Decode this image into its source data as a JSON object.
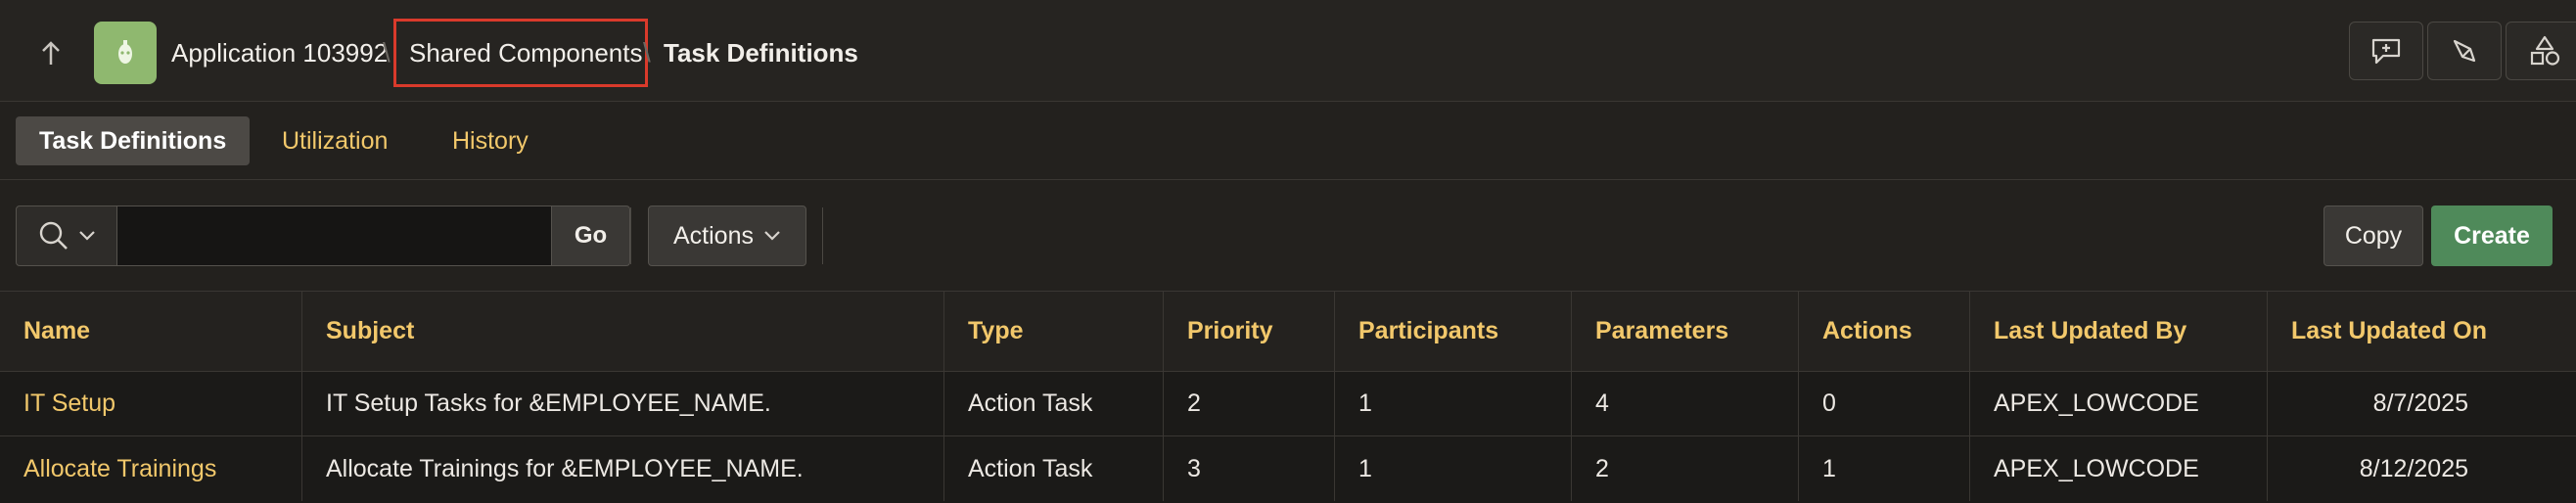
{
  "breadcrumb": {
    "app": "Application 103992",
    "shared": "Shared Components",
    "current": "Task Definitions"
  },
  "icons": {
    "up": "arrow-up-icon",
    "app": "app-icon",
    "feedback": "chat-plus-icon",
    "developer": "pen-icon",
    "shapes": "shapes-icon",
    "search": "magnifier-icon"
  },
  "tabs": [
    {
      "label": "Task Definitions",
      "active": true
    },
    {
      "label": "Utilization",
      "active": false
    },
    {
      "label": "History",
      "active": false
    }
  ],
  "toolbar": {
    "search_value": "",
    "go_label": "Go",
    "actions_label": "Actions",
    "copy_label": "Copy",
    "create_label": "Create"
  },
  "table": {
    "columns": [
      "Name",
      "Subject",
      "Type",
      "Priority",
      "Participants",
      "Parameters",
      "Actions",
      "Last Updated By",
      "Last Updated On"
    ],
    "rows": [
      [
        "IT Setup",
        "IT Setup Tasks for &EMPLOYEE_NAME.",
        "Action Task",
        "2",
        "1",
        "4",
        "0",
        "APEX_LOWCODE",
        "8/7/2025"
      ],
      [
        "Allocate Trainings",
        "Allocate Trainings for &EMPLOYEE_NAME.",
        "Action Task",
        "3",
        "1",
        "2",
        "1",
        "APEX_LOWCODE",
        "8/12/2025"
      ]
    ]
  },
  "colors": {
    "accent": "#f2c86b",
    "create": "#4f8a5a",
    "highlight": "#d93a2b",
    "app_icon": "#8fb86f"
  }
}
